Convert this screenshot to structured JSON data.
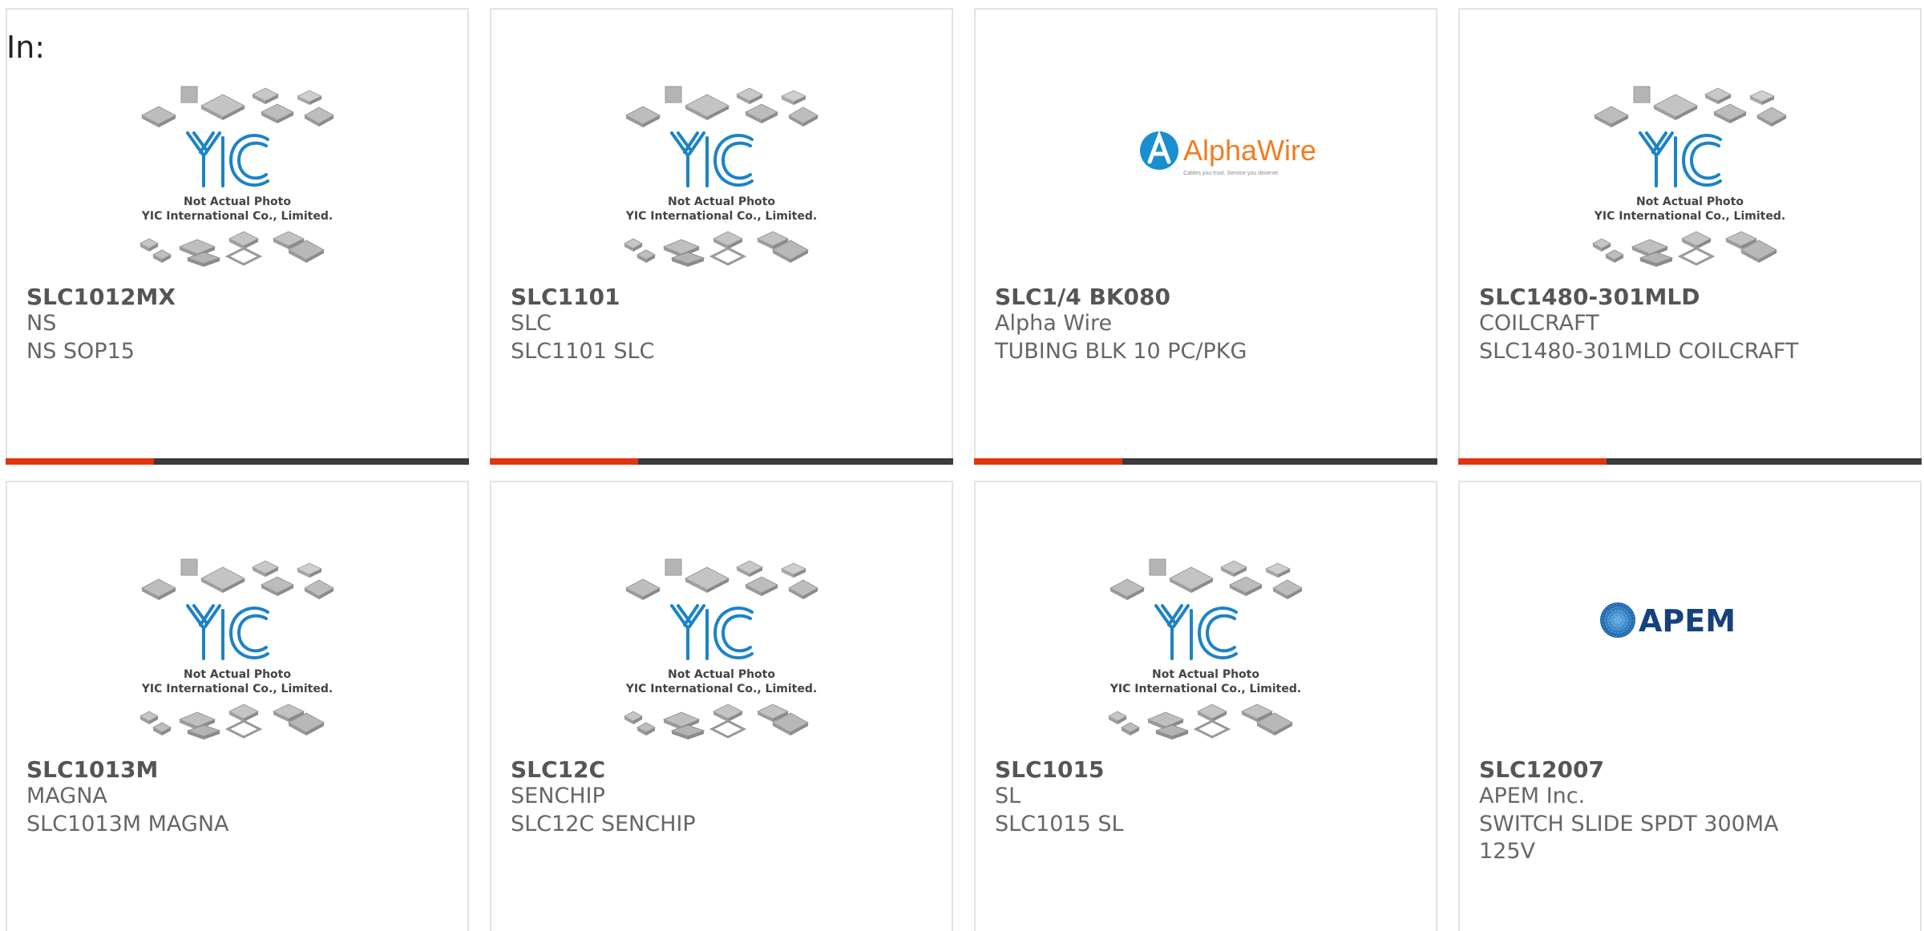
{
  "filter": {
    "label": "In:"
  },
  "colors": {
    "accent": "#e3350d",
    "bar": "#3b3b3b"
  },
  "placeholder": {
    "line1": "Not Actual Photo",
    "line2": "YIC International Co., Limited."
  },
  "logos": {
    "alphawire": {
      "name": "AlphaWire",
      "tagline": "Cables you trust. Service you deserve."
    },
    "apem": {
      "name": "APEM"
    }
  },
  "products": [
    {
      "part": "SLC1012MX",
      "mfr": "NS",
      "desc": "NS SOP15",
      "image": "yic-placeholder",
      "progress": 0.32
    },
    {
      "part": "SLC1101",
      "mfr": "SLC",
      "desc": "SLC1101 SLC",
      "image": "yic-placeholder",
      "progress": 0.32
    },
    {
      "part": "SLC1/4 BK080",
      "mfr": "Alpha Wire",
      "desc": "TUBING BLK 10 PC/PKG",
      "image": "alphawire-logo",
      "progress": 0.32
    },
    {
      "part": "SLC1480-301MLD",
      "mfr": "COILCRAFT",
      "desc": "SLC1480-301MLD COILCRAFT",
      "image": "yic-placeholder",
      "progress": 0.32
    },
    {
      "part": "SLC1013M",
      "mfr": "MAGNA",
      "desc": "SLC1013M MAGNA",
      "image": "yic-placeholder"
    },
    {
      "part": "SLC12C",
      "mfr": "SENCHIP",
      "desc": "SLC12C SENCHIP",
      "image": "yic-placeholder"
    },
    {
      "part": "SLC1015",
      "mfr": "SL",
      "desc": "SLC1015 SL",
      "image": "yic-placeholder"
    },
    {
      "part": "SLC12007",
      "mfr": "APEM Inc.",
      "desc": "SWITCH SLIDE SPDT 300MA 125V",
      "image": "apem-logo"
    }
  ]
}
